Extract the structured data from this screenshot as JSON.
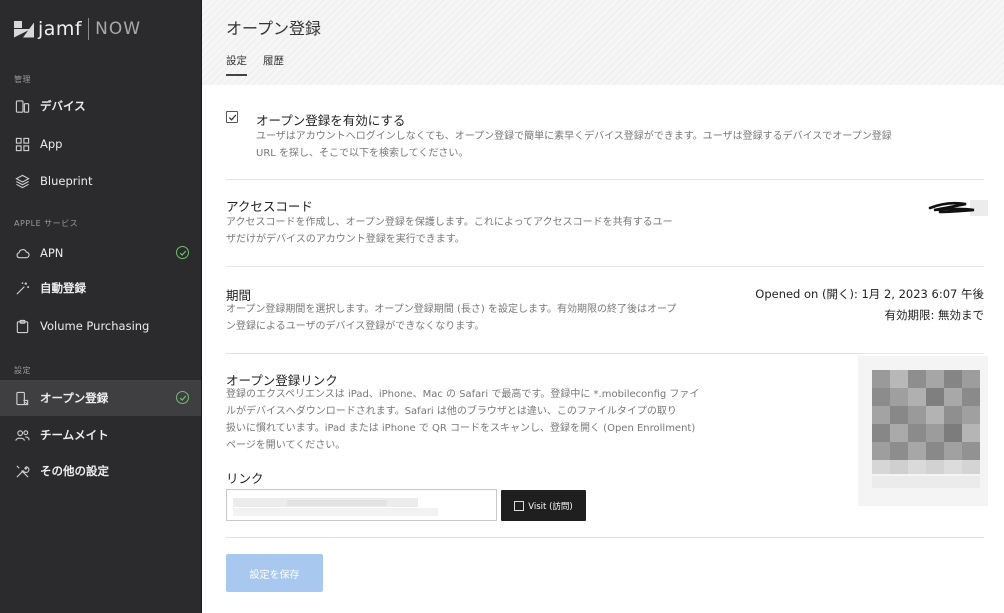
{
  "app": {
    "brand": "jamf",
    "product": "NOW"
  },
  "sidebar": {
    "sections": [
      {
        "label": "管理"
      },
      {
        "label": "APPLE サービス"
      },
      {
        "label": "設定"
      }
    ],
    "items": [
      {
        "label": "デバイス",
        "icon": "devices-icon"
      },
      {
        "label": "App",
        "icon": "apps-grid-icon"
      },
      {
        "label": "Blueprint",
        "icon": "layers-icon"
      },
      {
        "label": "APN",
        "icon": "cloud-icon",
        "status": "ok"
      },
      {
        "label": "自動登録",
        "icon": "magic-wand-icon"
      },
      {
        "label": "Volume Purchasing",
        "icon": "clipboard-icon"
      },
      {
        "label": "オープン登録",
        "icon": "enrollment-icon",
        "status": "ok",
        "active": true
      },
      {
        "label": "チームメイト",
        "icon": "people-icon"
      },
      {
        "label": "その他の設定",
        "icon": "tools-icon"
      }
    ]
  },
  "header": {
    "title": "オープン登録",
    "tabs": [
      {
        "label": "設定",
        "active": true
      },
      {
        "label": "履歴",
        "active": false
      }
    ]
  },
  "main": {
    "enable": {
      "label": "オープン登録を有効にする",
      "checked": true,
      "desc1": "ユーザはアカウントへログインしなくても、オープン登録で簡単に素早くデバイス登録ができます。ユーザは登録するデバイスでオープン登録",
      "desc2": "URL を探し、そこで以下を検索してください。"
    },
    "access_code": {
      "title": "アクセスコード",
      "desc1": "アクセスコードを作成し、オープン登録を保護します。これによってアクセスコードを共有するユー",
      "desc2": "ザだけがデバイスのアカウント登録を実行できます。"
    },
    "period": {
      "title": "期間",
      "desc1": "オープン登録期間を選択します。オープン登録期間 (長さ) を設定します。有効期限の終了後はオープ",
      "desc2": "ン登録によるユーザのデバイス登録ができなくなります。",
      "opened": "Opened on (開く): 1月 2, 2023 6:07 午後",
      "expiry": "有効期限: 無効まで"
    },
    "link_section": {
      "title": "オープン登録リンク",
      "desc1": "登録のエクスペリエンスは iPad、iPhone、Mac の Safari で最高です。登録中に *.mobileconfig ファイ",
      "desc2": "ルがデバイスへダウンロードされます。Safari は他のブラウザとは違い、このファイルタイプの取り",
      "desc3": "扱いに慣れています。iPad または iPhone で QR コードをスキャンし、登録を開く (Open Enrollment)",
      "desc4": "ページを開いてください。",
      "link_label": "リンク",
      "visit_label": "Visit (訪問)"
    },
    "save_label": "設定を保存"
  },
  "colors": {
    "sidebar_bg": "#2b2b2d",
    "active_item": "#3f3f42",
    "status_green": "#6ec06e",
    "save_button": "#a8c8ef",
    "visit_button": "#1f1f1f"
  }
}
